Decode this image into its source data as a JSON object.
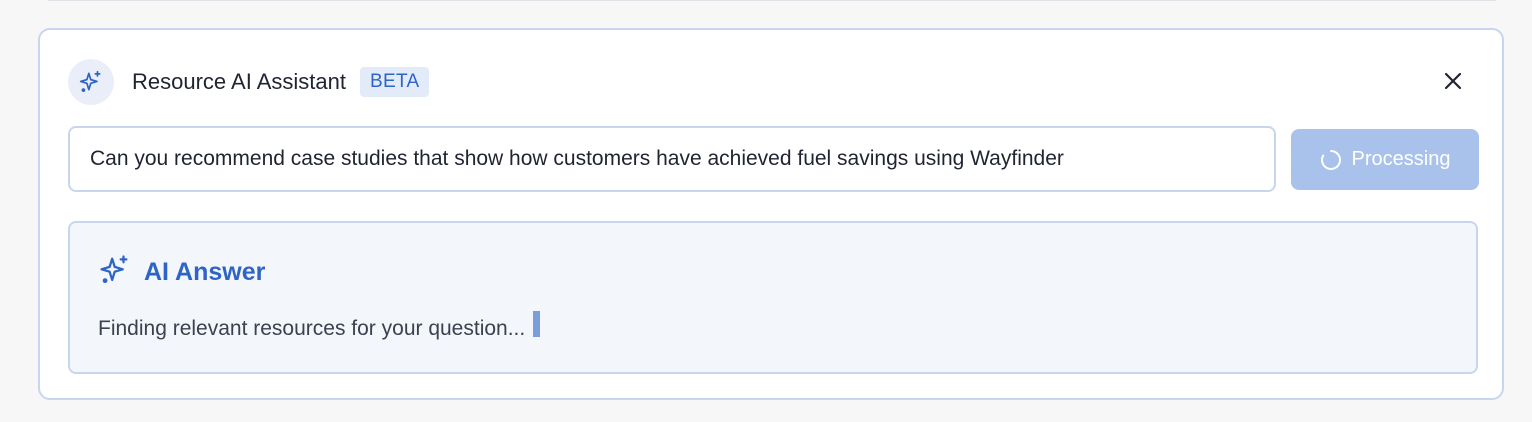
{
  "assistant": {
    "title": "Resource AI Assistant",
    "badge": "BETA",
    "icons": {
      "header": "sparkle-icon",
      "close": "close-icon",
      "spinner": "spinner-icon",
      "answer": "sparkle-icon"
    }
  },
  "query": {
    "value": "Can you recommend case studies that show how customers have achieved fuel savings using Wayfinder",
    "button_label": "Processing"
  },
  "answer": {
    "title": "AI Answer",
    "status_text": "Finding relevant resources for your question..."
  },
  "colors": {
    "accent": "#2f64c7",
    "button_disabled": "#a9c2ec",
    "border": "#c9d5ef",
    "answer_background": "#f3f6fb"
  }
}
